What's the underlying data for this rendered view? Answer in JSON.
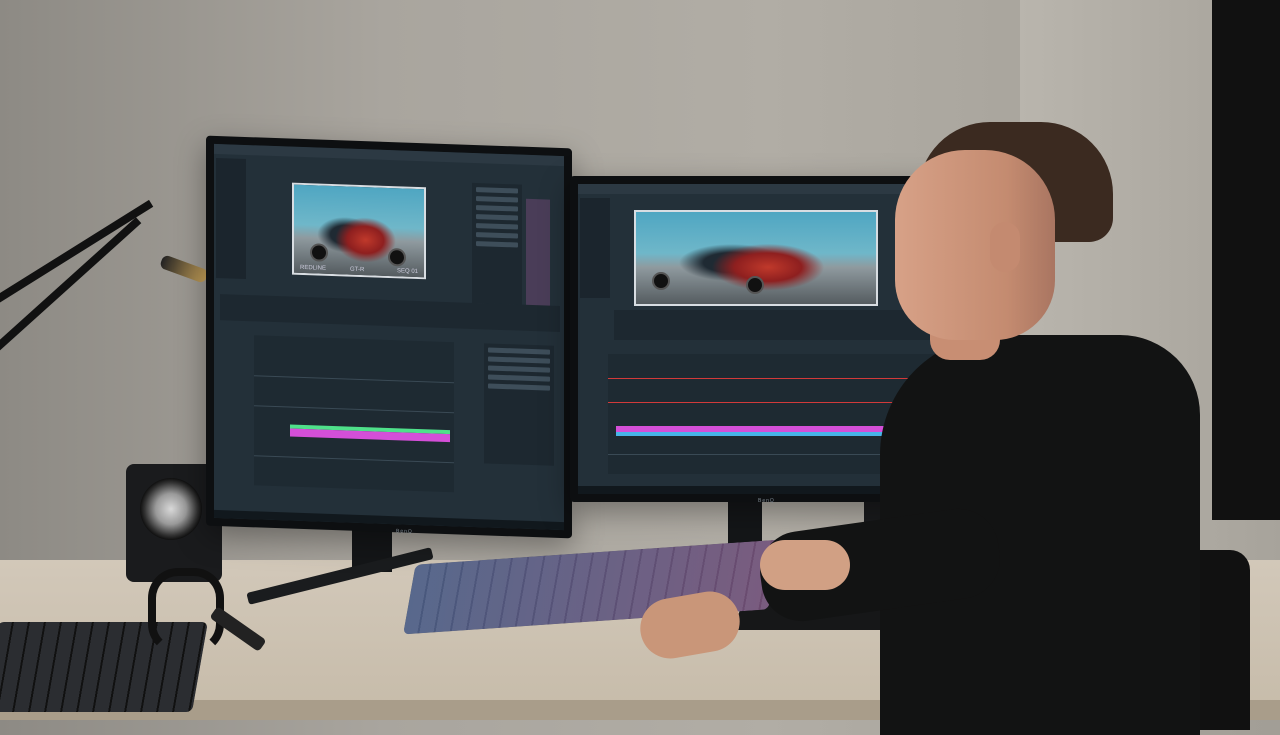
{
  "scene": {
    "description_tags": [
      "video-editing-desk",
      "dual-monitor",
      "person"
    ]
  },
  "left_monitor": {
    "brand_label": "BenQ",
    "viewer_caption_left": "REDLINE",
    "viewer_caption_mid": "GT-R",
    "viewer_caption_right": "SEQ 01"
  },
  "right_monitor": {
    "brand_label": "BenQ"
  },
  "colors": {
    "clip_pink": "#d44fd8",
    "clip_green": "#4fe08a",
    "clip_blue": "#48b4e8",
    "playhead_red": "#d23a3a",
    "ui_background": "#233039"
  }
}
